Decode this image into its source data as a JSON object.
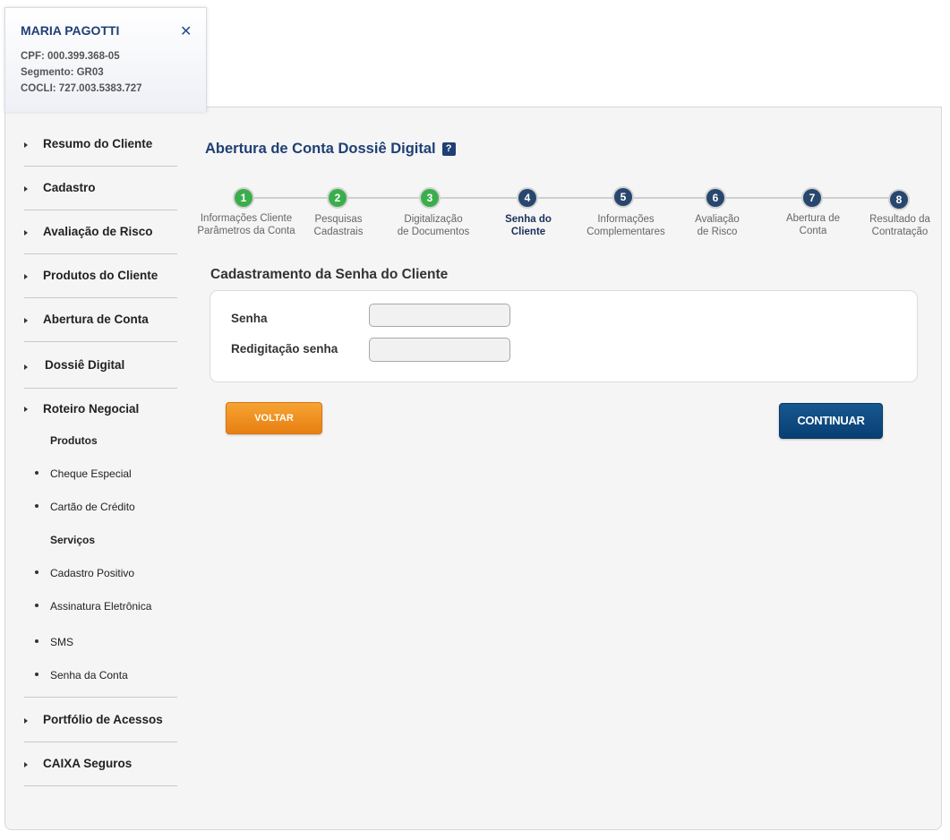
{
  "client": {
    "name": "MARIA PAGOTTI",
    "close_glyph": "✕",
    "cpf": "CPF: 000.399.368-05",
    "segmento": "Segmento: GR03",
    "cocli": "COCLI: 727.003.5383.727"
  },
  "sidebar": {
    "items": [
      {
        "label": "Resumo do Cliente"
      },
      {
        "label": "Cadastro"
      },
      {
        "label": "Avaliação de Risco"
      },
      {
        "label": "Produtos do Cliente"
      },
      {
        "label": "Abertura de Conta"
      },
      {
        "label": "Dossiê Digital"
      },
      {
        "label": "Roteiro Negocial"
      },
      {
        "label": "Portfólio de Acessos"
      },
      {
        "label": "CAIXA Seguros"
      }
    ],
    "roteiro": {
      "produtos_heading": "Produtos",
      "produtos": [
        "Cheque Especial",
        "Cartão de Crédito"
      ],
      "servicos_heading": "Serviços",
      "servicos": [
        "Cadastro Positivo",
        "Assinatura Eletrônica",
        "SMS",
        "Senha da Conta"
      ]
    }
  },
  "page": {
    "title": "Abertura de Conta Dossiê Digital",
    "help_glyph": "?"
  },
  "steps": [
    {
      "number": "1",
      "line1": "Informações Cliente",
      "line2": "Parâmetros da Conta",
      "status": "done"
    },
    {
      "number": "2",
      "line1": "Pesquisas",
      "line2": "Cadastrais",
      "status": "done"
    },
    {
      "number": "3",
      "line1": "Digitalização",
      "line2": "de Documentos",
      "status": "done"
    },
    {
      "number": "4",
      "line1": "Senha do",
      "line2": "Cliente",
      "status": "current"
    },
    {
      "number": "5",
      "line1": "Informações",
      "line2": "Complementares",
      "status": "todo"
    },
    {
      "number": "6",
      "line1": "Avaliação",
      "line2": "de Risco",
      "status": "todo"
    },
    {
      "number": "7",
      "line1": "Abertura de",
      "line2": "Conta",
      "status": "todo"
    },
    {
      "number": "8",
      "line1": "Resultado da",
      "line2": "Contratação",
      "status": "todo"
    }
  ],
  "form": {
    "section_title": "Cadastramento da  Senha do Cliente",
    "senha_label": "Senha",
    "senha_value": "",
    "redigitacao_label": "Redigitação senha",
    "redigitacao_value": ""
  },
  "buttons": {
    "voltar": "VOLTAR",
    "continuar": "CONTINUAR"
  },
  "colors": {
    "step_done": "#3bae4c",
    "step_todo": "#28476f",
    "title": "#1f3f75",
    "voltar": "#f39423",
    "continuar": "#0d4a83"
  }
}
